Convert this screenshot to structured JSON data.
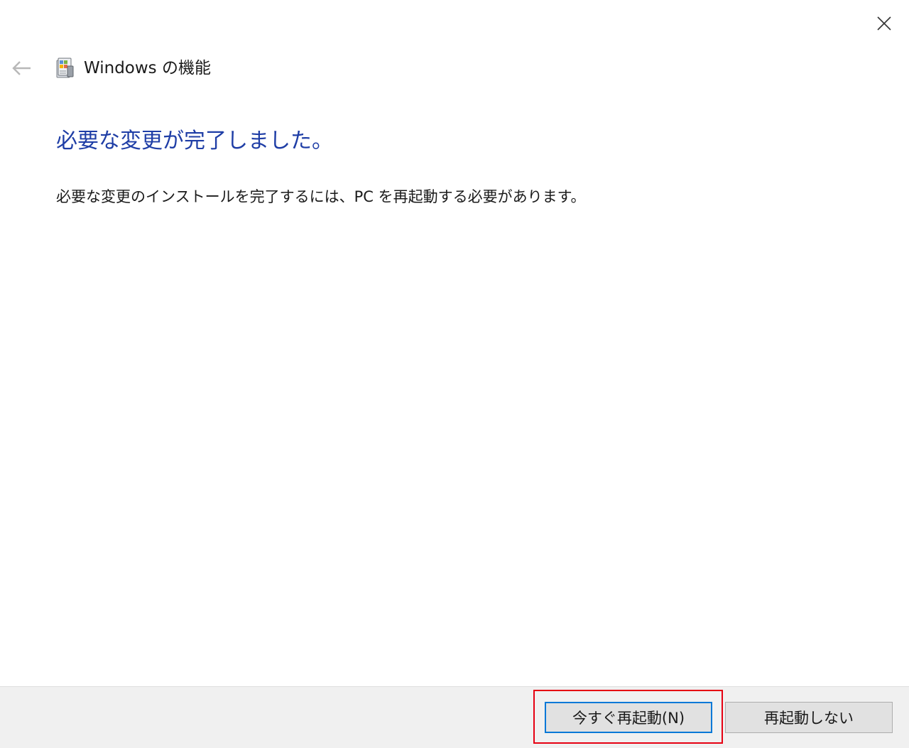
{
  "window": {
    "title": "Windows の機能",
    "close_icon": "close-icon",
    "back_icon": "back-arrow-icon",
    "app_icon": "windows-features-icon"
  },
  "content": {
    "heading": "必要な変更が完了しました。",
    "message": "必要な変更のインストールを完了するには、PC を再起動する必要があります。"
  },
  "footer": {
    "restart_now_label": "今すぐ再起動(N)",
    "dont_restart_label": "再起動しない"
  },
  "colors": {
    "heading": "#1f3ea6",
    "accent": "#0078d7",
    "highlight": "#e60012",
    "footer_bg": "#f0f0f0"
  }
}
